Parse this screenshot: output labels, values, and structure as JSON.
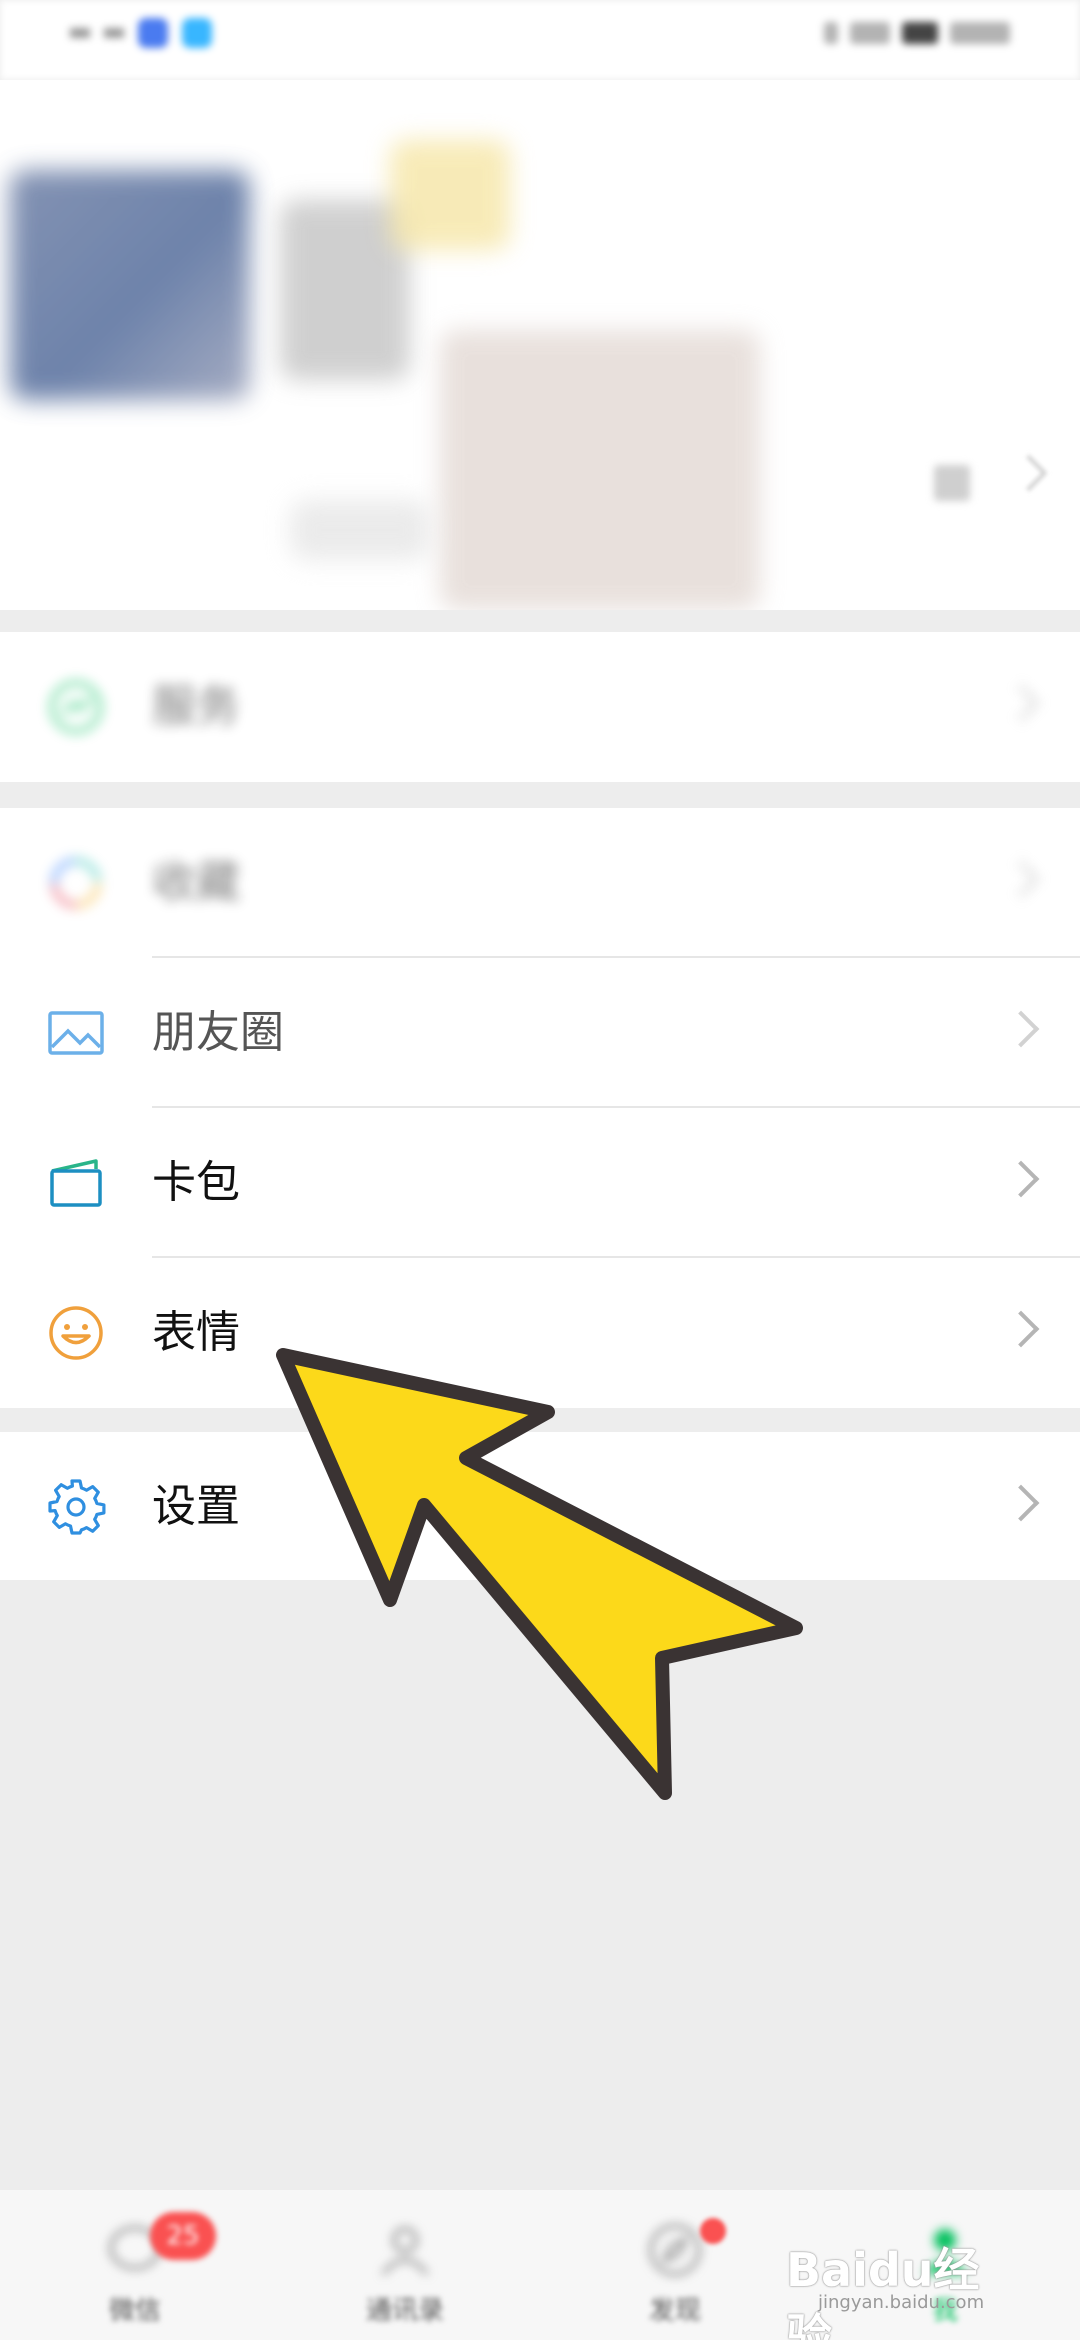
{
  "menu": {
    "items": [
      {
        "label": "服务",
        "icon": "service-icon"
      },
      {
        "label": "收藏",
        "icon": "favorites-icon"
      },
      {
        "label": "朋友圈",
        "icon": "moments-icon"
      },
      {
        "label": "卡包",
        "icon": "card-wallet-icon"
      },
      {
        "label": "表情",
        "icon": "sticker-emoji-icon"
      },
      {
        "label": "设置",
        "icon": "settings-gear-icon"
      }
    ]
  },
  "tabbar": {
    "tabs": [
      {
        "label": "微信",
        "icon": "chat-icon",
        "badge": "25"
      },
      {
        "label": "通讯录",
        "icon": "contacts-icon"
      },
      {
        "label": "发现",
        "icon": "discover-icon",
        "dot": true
      },
      {
        "label": "我",
        "icon": "me-icon"
      }
    ]
  },
  "watermark": {
    "brand": "Baidu经验",
    "sub": "jingyan.baidu.com"
  },
  "colors": {
    "background": "#ededed",
    "cell": "#ffffff",
    "wechat_green": "#07c160",
    "badge_red": "#fa5151",
    "arrow_fill": "#fcd91a",
    "arrow_stroke": "#3a3333",
    "icon_blue": "#2f8fe0",
    "icon_teal": "#1d8fc2",
    "icon_orange": "#f0a03c"
  }
}
